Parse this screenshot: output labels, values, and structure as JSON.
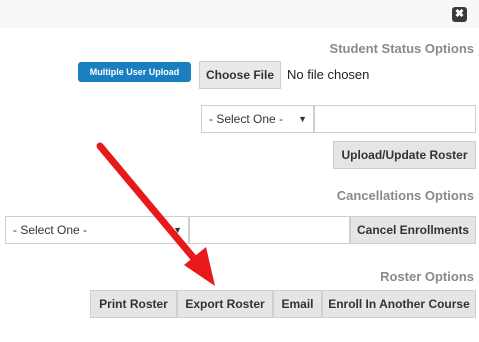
{
  "dialog": {
    "close_glyph": "✖",
    "close_icon": "close-icon"
  },
  "student_status": {
    "title": "Student Status Options",
    "multi_upload_label": "Multiple User Upload",
    "choose_file_label": "Choose File",
    "file_status": "No file chosen",
    "select_value": "- Select One -",
    "text_value": "",
    "upload_label": "Upload/Update Roster"
  },
  "cancellations": {
    "title": "Cancellations Options",
    "select_value": "- Select One -",
    "text_value": "",
    "cancel_label": "Cancel Enrollments"
  },
  "roster": {
    "title": "Roster Options",
    "buttons": [
      "Print Roster",
      "Export Roster",
      "Email",
      "Enroll In Another Course"
    ]
  },
  "annotation": {
    "arrow_color": "#e8191b"
  }
}
